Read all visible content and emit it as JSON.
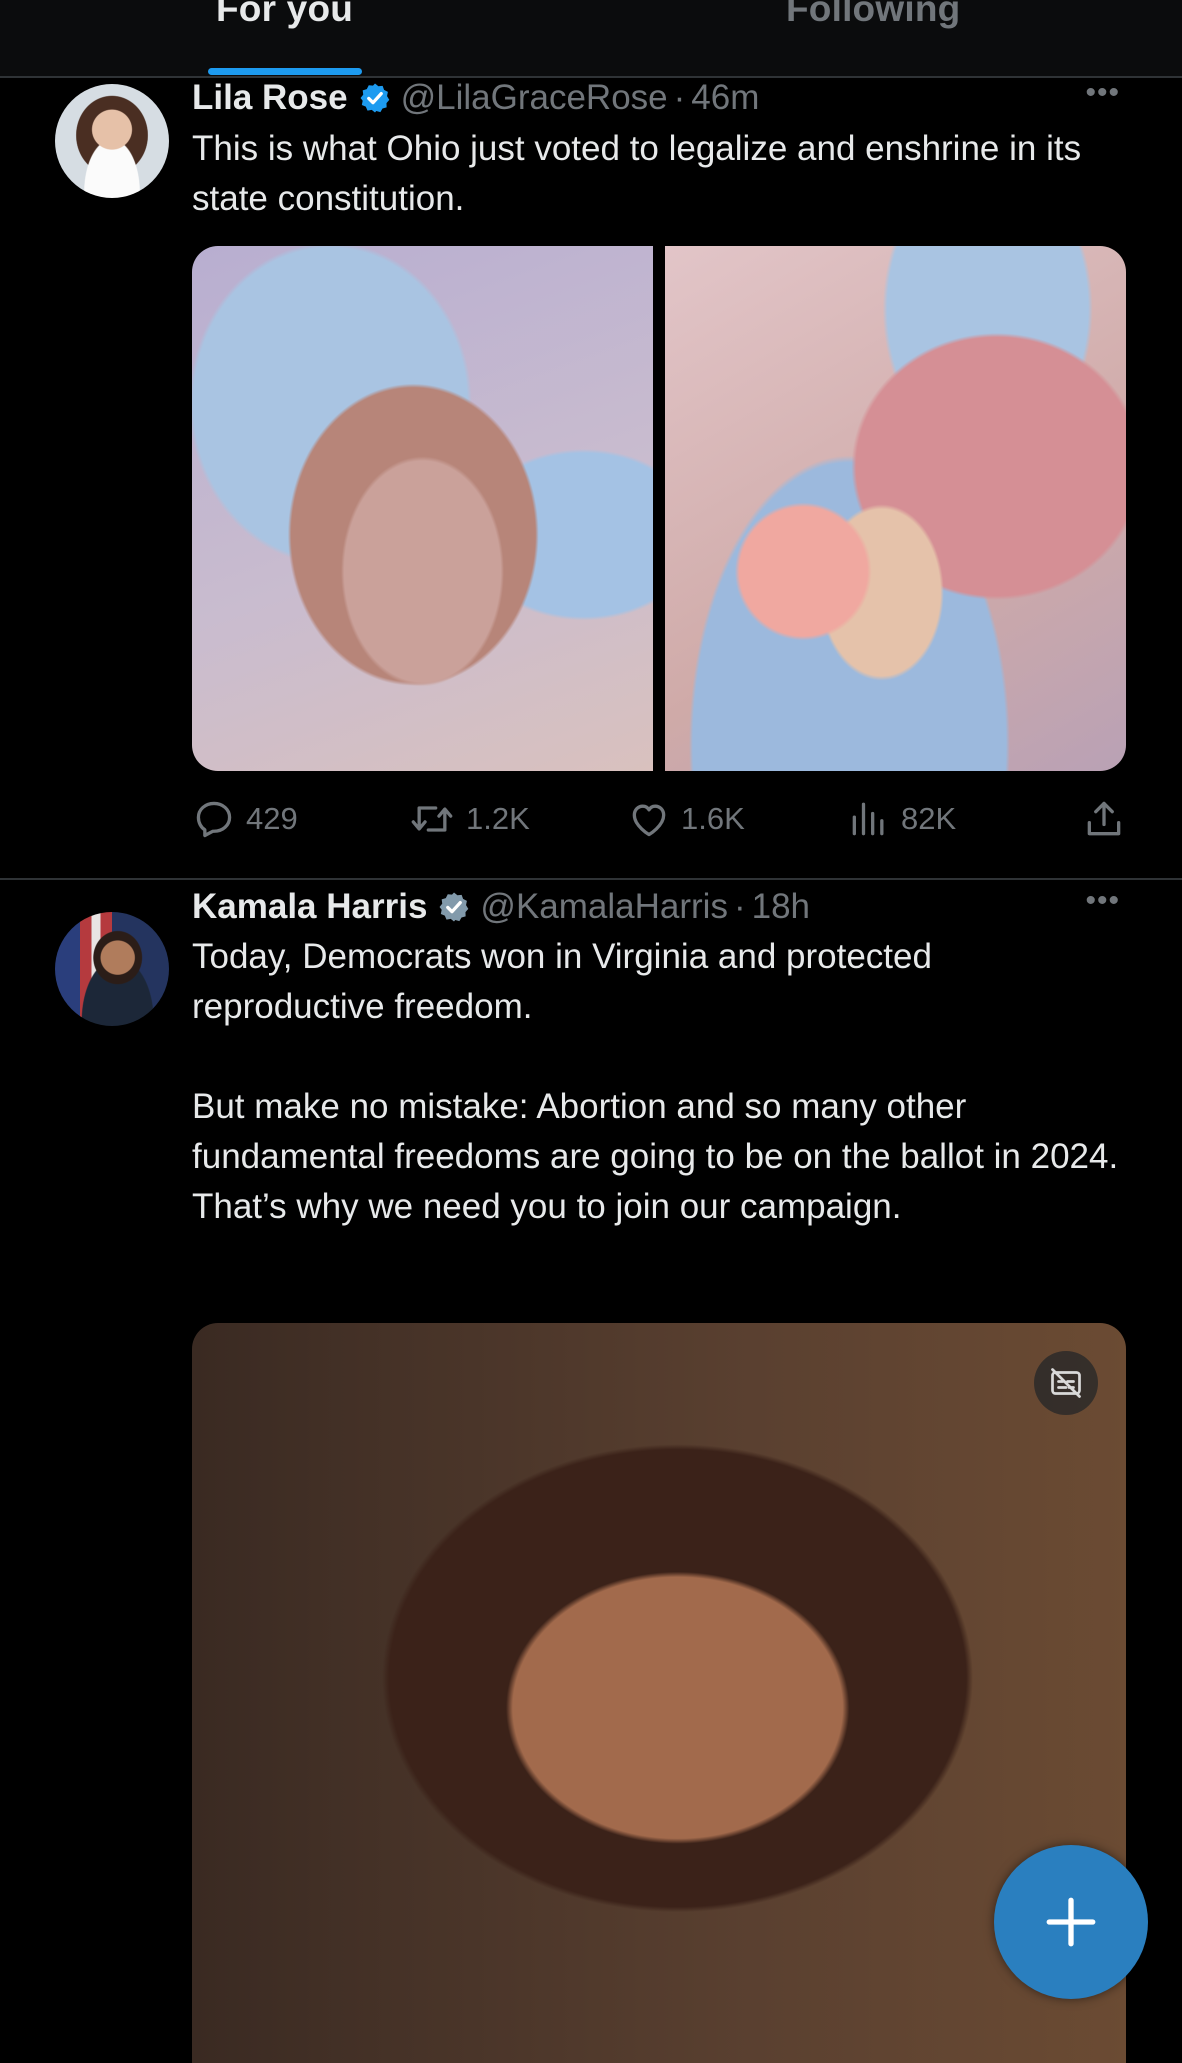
{
  "tabs": {
    "for_you": "For you",
    "following": "Following",
    "active": "For you"
  },
  "tweets": [
    {
      "name": "Lila Rose",
      "handle": "@LilaGraceRose",
      "separator": "·",
      "time": "46m",
      "more": "•••",
      "text": "This is what Ohio just voted to legalize and enshrine in its state constitution.",
      "stats": {
        "replies": "429",
        "reposts": "1.2K",
        "likes": "1.6K",
        "views": "82K"
      }
    },
    {
      "name": "Kamala Harris",
      "handle": "@KamalaHarris",
      "separator": "·",
      "time": "18h",
      "more": "•••",
      "text": "Today, Democrats won in Virginia and protected reproductive freedom.\n\nBut make no mistake: Abortion and so many other fundamental freedoms are going to be on the ballot in 2024. That’s why we need you to join our campaign."
    }
  ],
  "colors": {
    "accent": "#1d9bf0",
    "text_primary": "#e7e9ea",
    "text_secondary": "#71767b",
    "divider": "#2f3336",
    "fab": "#2a7fbf"
  },
  "icons": {
    "verified": "verified-badge-icon",
    "reply": "reply-icon",
    "repost": "repost-icon",
    "like": "heart-icon",
    "views": "views-chart-icon",
    "share": "share-icon",
    "captions": "captions-off-icon",
    "compose": "plus-icon"
  }
}
